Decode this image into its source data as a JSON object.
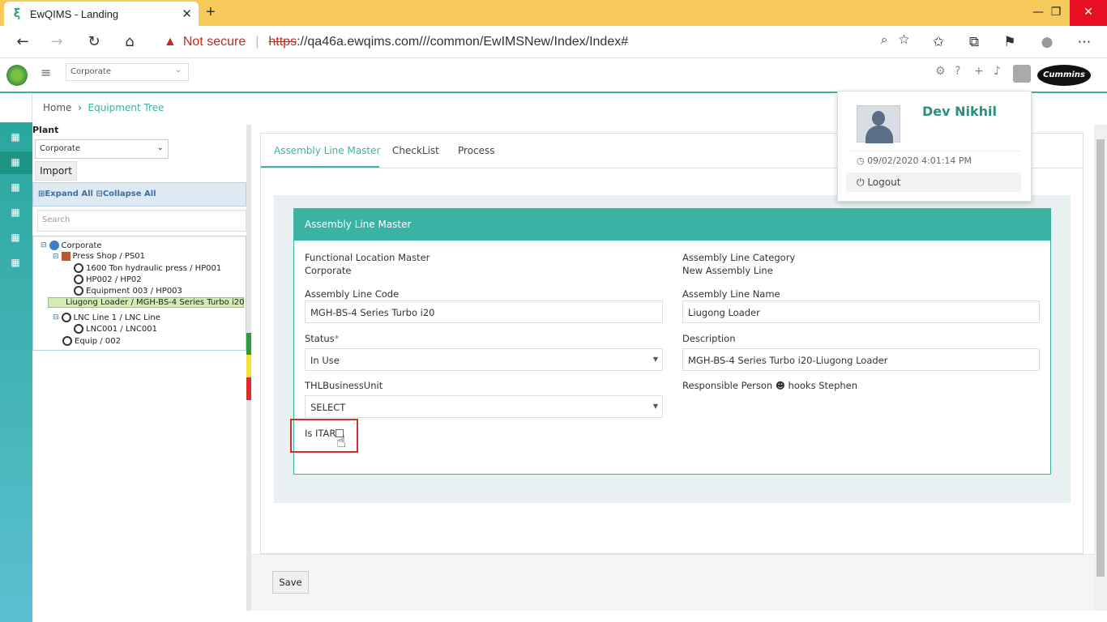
{
  "browser": {
    "tab_title": "EwQIMS - Landing",
    "not_secure": "Not secure",
    "url_scheme": "https",
    "url_rest": "://qa46a.ewqims.com///common/EwIMSNew/Index/Index#"
  },
  "header": {
    "org_select": "Corporate"
  },
  "breadcrumb": {
    "home": "Home",
    "current": "Equipment Tree"
  },
  "left_panel": {
    "plant_label": "Plant",
    "plant_value": "Corporate",
    "import_label": "Import",
    "expand_all": "Expand All",
    "collapse_all": "Collapse All",
    "search_placeholder": "Search",
    "tree": [
      "Corporate",
      "Press Shop / PS01",
      "1600 Ton hydraulic press / HP001",
      "HP002 / HP02",
      "Equipment 003 / HP003",
      "Liugong Loader / MGH-BS-4 Series Turbo i20",
      "LNC Line 1 / LNC Line",
      "LNC001 / LNC001",
      "Equip / 002"
    ]
  },
  "tabs": [
    "Assembly Line Master",
    "CheckList",
    "Process"
  ],
  "card": {
    "title": "Assembly Line Master",
    "functional_location_label": "Functional Location Master",
    "functional_location_value": "Corporate",
    "category_label": "Assembly Line Category",
    "category_value": "New Assembly Line",
    "code_label": "Assembly Line Code",
    "code_value": "MGH-BS-4 Series Turbo i20",
    "name_label": "Assembly Line Name",
    "name_value": "Liugong Loader",
    "status_label": "Status",
    "status_required": "*",
    "status_value": "In Use",
    "description_label": "Description",
    "description_value": "MGH-BS-4 Series Turbo i20-Liugong Loader",
    "business_unit_label": "THLBusinessUnit",
    "business_unit_value": "SELECT",
    "responsible_label": "Responsible Person",
    "responsible_value": "hooks Stephen",
    "itar_label": "Is ITAR"
  },
  "footer": {
    "save_label": "Save"
  },
  "user_popup": {
    "name": "Dev Nikhil",
    "timestamp": "09/02/2020 4:01:14 PM",
    "logout": "Logout"
  },
  "colors": {
    "accent": "#3bb3a4",
    "tab_bar": "#f5c95a",
    "status_green": "#2e9a3a",
    "status_yellow": "#f4e23a",
    "status_red": "#e02b2b"
  }
}
